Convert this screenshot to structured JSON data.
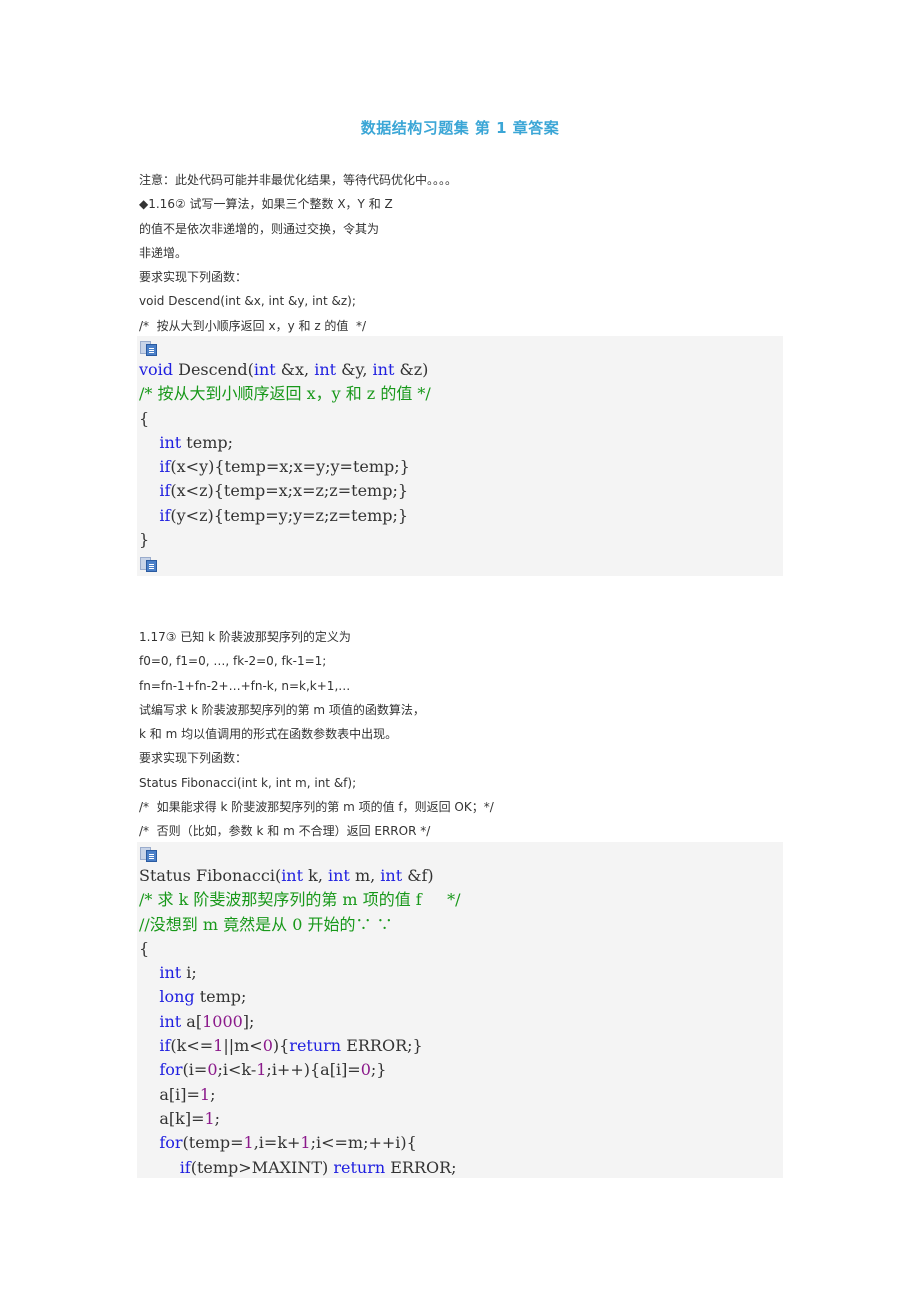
{
  "title": "数据结构习题集 第 1 章答案",
  "section1": {
    "intro_lines": [
      "注意：此处代码可能并非最优化结果，等待代码优化中。。。。",
      "◆1.16② 试写一算法，如果三个整数 X，Y 和 Z",
      "的值不是依次非递增的，则通过交换，令其为",
      "非递增。",
      "要求实现下列函数：",
      "void Descend(int &x, int &y, int &z);",
      "/*  按从大到小顺序返回 x，y 和 z 的值  */"
    ],
    "code_icon": "copy-code-icon",
    "code": [
      [
        {
          "t": "void",
          "c": "kw"
        },
        {
          "t": " Descend("
        },
        {
          "t": "int",
          "c": "kw"
        },
        {
          "t": " &x, "
        },
        {
          "t": "int",
          "c": "kw"
        },
        {
          "t": " &y, "
        },
        {
          "t": "int",
          "c": "kw"
        },
        {
          "t": " &z)"
        }
      ],
      [
        {
          "t": "/* 按从大到小顺序返回 x，y 和 z 的值 */",
          "c": "cm"
        }
      ],
      [
        {
          "t": "{"
        }
      ],
      [
        {
          "t": "    "
        },
        {
          "t": "int",
          "c": "kw"
        },
        {
          "t": " temp;"
        }
      ],
      [
        {
          "t": "    "
        },
        {
          "t": "if",
          "c": "kw"
        },
        {
          "t": "(x<y){temp=x;x=y;y=temp;}"
        }
      ],
      [
        {
          "t": "    "
        },
        {
          "t": "if",
          "c": "kw"
        },
        {
          "t": "(x<z){temp=x;x=z;z=temp;}"
        }
      ],
      [
        {
          "t": "    "
        },
        {
          "t": "if",
          "c": "kw"
        },
        {
          "t": "(y<z){temp=y;y=z;z=temp;}"
        }
      ],
      [
        {
          "t": "}"
        }
      ]
    ]
  },
  "section2": {
    "intro_lines": [
      "1.17③ 已知 k 阶裴波那契序列的定义为",
      "f0=0, f1=0, …, fk-2=0, fk-1=1;",
      "fn=fn-1+fn-2+…+fn-k, n=k,k+1,…",
      "试编写求 k 阶裴波那契序列的第 m 项值的函数算法，",
      "k 和 m 均以值调用的形式在函数参数表中出现。",
      "要求实现下列函数：",
      "Status Fibonacci(int k, int m, int &f);",
      "/*  如果能求得 k 阶斐波那契序列的第 m 项的值 f，则返回 OK；*/",
      "/*  否则（比如，参数 k 和 m 不合理）返回 ERROR */"
    ],
    "code_icon": "copy-code-icon",
    "code": [
      [
        {
          "t": "Status Fibonacci("
        },
        {
          "t": "int",
          "c": "kw"
        },
        {
          "t": " k, "
        },
        {
          "t": "int",
          "c": "kw"
        },
        {
          "t": " m, "
        },
        {
          "t": "int",
          "c": "kw"
        },
        {
          "t": " &f)"
        }
      ],
      [
        {
          "t": "/* 求 k 阶斐波那契序列的第 m 项的值 f     */",
          "c": "cm"
        }
      ],
      [
        {
          "t": "//没想到 m 竟然是从 0 开始的∵ ∵",
          "c": "cm"
        }
      ],
      [
        {
          "t": "{"
        }
      ],
      [
        {
          "t": "    "
        },
        {
          "t": "int",
          "c": "kw"
        },
        {
          "t": " i;"
        }
      ],
      [
        {
          "t": "    "
        },
        {
          "t": "long",
          "c": "kw"
        },
        {
          "t": " temp;"
        }
      ],
      [
        {
          "t": "    "
        },
        {
          "t": "int",
          "c": "kw"
        },
        {
          "t": " a["
        },
        {
          "t": "1000",
          "c": "num"
        },
        {
          "t": "];"
        }
      ],
      [
        {
          "t": "    "
        },
        {
          "t": "if",
          "c": "kw"
        },
        {
          "t": "(k<="
        },
        {
          "t": "1",
          "c": "num"
        },
        {
          "t": "||m<"
        },
        {
          "t": "0",
          "c": "num"
        },
        {
          "t": "){"
        },
        {
          "t": "return",
          "c": "kw"
        },
        {
          "t": " ERROR;}"
        }
      ],
      [
        {
          "t": "    "
        },
        {
          "t": "for",
          "c": "kw"
        },
        {
          "t": "(i="
        },
        {
          "t": "0",
          "c": "num"
        },
        {
          "t": ";i<k-"
        },
        {
          "t": "1",
          "c": "num"
        },
        {
          "t": ";i++){a[i]="
        },
        {
          "t": "0",
          "c": "num"
        },
        {
          "t": ";}"
        }
      ],
      [
        {
          "t": "    a[i]="
        },
        {
          "t": "1",
          "c": "num"
        },
        {
          "t": ";"
        }
      ],
      [
        {
          "t": "    a[k]="
        },
        {
          "t": "1",
          "c": "num"
        },
        {
          "t": ";"
        }
      ],
      [
        {
          "t": "    "
        },
        {
          "t": "for",
          "c": "kw"
        },
        {
          "t": "(temp="
        },
        {
          "t": "1",
          "c": "num"
        },
        {
          "t": ",i=k+"
        },
        {
          "t": "1",
          "c": "num"
        },
        {
          "t": ";i<=m;++i){"
        }
      ],
      [
        {
          "t": "        "
        },
        {
          "t": "if",
          "c": "kw"
        },
        {
          "t": "(temp>MAXINT) "
        },
        {
          "t": "return",
          "c": "kw"
        },
        {
          "t": " ERROR;"
        }
      ]
    ]
  }
}
